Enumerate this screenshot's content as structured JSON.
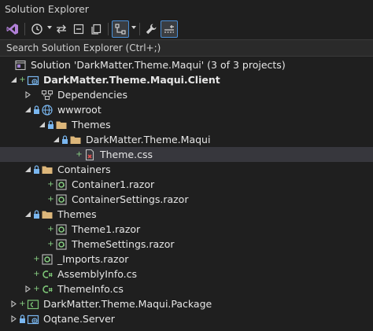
{
  "window": {
    "title": "Solution Explorer"
  },
  "search": {
    "placeholder": "Search Solution Explorer (Ctrl+;)"
  },
  "tree": {
    "solution": "Solution 'DarkMatter.Theme.Maqui' (3 of 3 projects)",
    "client": "DarkMatter.Theme.Maqui.Client",
    "dependencies": "Dependencies",
    "wwwroot": "wwwroot",
    "themes_dir": "Themes",
    "maqui_dir": "DarkMatter.Theme.Maqui",
    "theme_css": "Theme.css",
    "containers": "Containers",
    "container1": "Container1.razor",
    "container_settings": "ContainerSettings.razor",
    "themes": "Themes",
    "theme1": "Theme1.razor",
    "theme_settings": "ThemeSettings.razor",
    "imports": "_Imports.razor",
    "assembly_info": "AssemblyInfo.cs",
    "theme_info": "ThemeInfo.cs",
    "package": "DarkMatter.Theme.Maqui.Package",
    "server": "Oqtane.Server"
  },
  "colors": {
    "background": "#1f1f1f",
    "selected_row": "#37373d",
    "folder": "#dcb67a",
    "pending_add": "#89d185",
    "lock": "#7ab7f0",
    "csharp": "#7cc576"
  }
}
